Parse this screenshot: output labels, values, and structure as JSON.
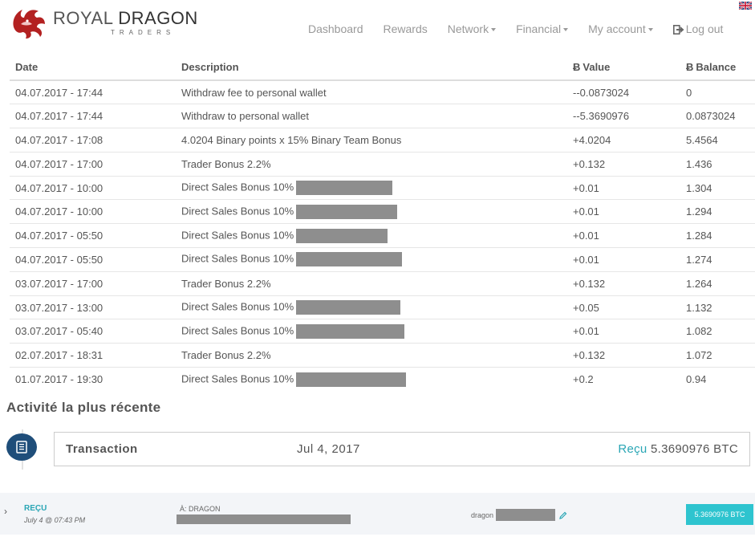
{
  "brand": {
    "name_part1": "ROYAL ",
    "name_part2": "DRAGON",
    "tagline": "TRADERS"
  },
  "nav": {
    "items": [
      {
        "label": "Dashboard",
        "dropdown": false
      },
      {
        "label": "Rewards",
        "dropdown": false
      },
      {
        "label": "Network",
        "dropdown": true
      },
      {
        "label": "Financial",
        "dropdown": true
      },
      {
        "label": "My account",
        "dropdown": true
      }
    ],
    "logout_label": "Log out",
    "logout_icon": "logout-icon",
    "language_flag": "uk-flag-icon"
  },
  "table": {
    "headers": {
      "date": "Date",
      "description": "Description",
      "value": "Value",
      "balance": "Balance",
      "currency_symbol": "Ƀ"
    },
    "rows": [
      {
        "date": "04.07.2017 - 17:44",
        "description": "Withdraw fee to personal wallet",
        "redacted": false,
        "value": "--0.0873024",
        "sign": "neg",
        "balance": "0"
      },
      {
        "date": "04.07.2017 - 17:44",
        "description": "Withdraw to personal wallet",
        "redacted": false,
        "value": "--5.3690976",
        "sign": "neg",
        "balance": "0.0873024"
      },
      {
        "date": "04.07.2017 - 17:08",
        "description": "4.0204 Binary points x 15% Binary Team Bonus",
        "redacted": false,
        "value": "+4.0204",
        "sign": "pos",
        "balance": "5.4564"
      },
      {
        "date": "04.07.2017 - 17:00",
        "description": "Trader Bonus 2.2%",
        "redacted": false,
        "value": "+0.132",
        "sign": "pos",
        "balance": "1.436"
      },
      {
        "date": "04.07.2017 - 10:00",
        "description": "Direct Sales Bonus 10%",
        "redacted": true,
        "value": "+0.01",
        "sign": "pos",
        "balance": "1.304"
      },
      {
        "date": "04.07.2017 - 10:00",
        "description": "Direct Sales Bonus 10%",
        "redacted": true,
        "value": "+0.01",
        "sign": "pos",
        "balance": "1.294"
      },
      {
        "date": "04.07.2017 - 05:50",
        "description": "Direct Sales Bonus 10%",
        "redacted": true,
        "value": "+0.01",
        "sign": "pos",
        "balance": "1.284"
      },
      {
        "date": "04.07.2017 - 05:50",
        "description": "Direct Sales Bonus 10%",
        "redacted": true,
        "value": "+0.01",
        "sign": "pos",
        "balance": "1.274"
      },
      {
        "date": "03.07.2017 - 17:00",
        "description": "Trader Bonus 2.2%",
        "redacted": false,
        "value": "+0.132",
        "sign": "pos",
        "balance": "1.264"
      },
      {
        "date": "03.07.2017 - 13:00",
        "description": "Direct Sales Bonus 10%",
        "redacted": true,
        "value": "+0.05",
        "sign": "pos",
        "balance": "1.132"
      },
      {
        "date": "03.07.2017 - 05:40",
        "description": "Direct Sales Bonus 10%",
        "redacted": true,
        "value": "+0.01",
        "sign": "pos",
        "balance": "1.082"
      },
      {
        "date": "02.07.2017 - 18:31",
        "description": "Trader Bonus 2.2%",
        "redacted": false,
        "value": "+0.132",
        "sign": "pos",
        "balance": "1.072"
      },
      {
        "date": "01.07.2017 - 19:30",
        "description": "Direct Sales Bonus 10%",
        "redacted": true,
        "value": "+0.2",
        "sign": "pos",
        "balance": "0.94"
      }
    ]
  },
  "recent": {
    "title": "Activité la plus récente",
    "icon": "receipt-icon",
    "transaction_label": "Transaction",
    "transaction_date": "Jul 4, 2017",
    "status_word": "Reçu",
    "amount": "5.3690976 BTC"
  },
  "detail_row": {
    "status": "REÇU",
    "datetime": "July 4 @ 07:43 PM",
    "to_label": "À: DRAGON",
    "name_label": "dragon",
    "amount_button": "5.3690976 BTC"
  },
  "colors": {
    "negative": "#a94442",
    "positive": "#3c9c3c",
    "accent": "#2ec4cf",
    "timeline_dot": "#1f4e7a"
  }
}
